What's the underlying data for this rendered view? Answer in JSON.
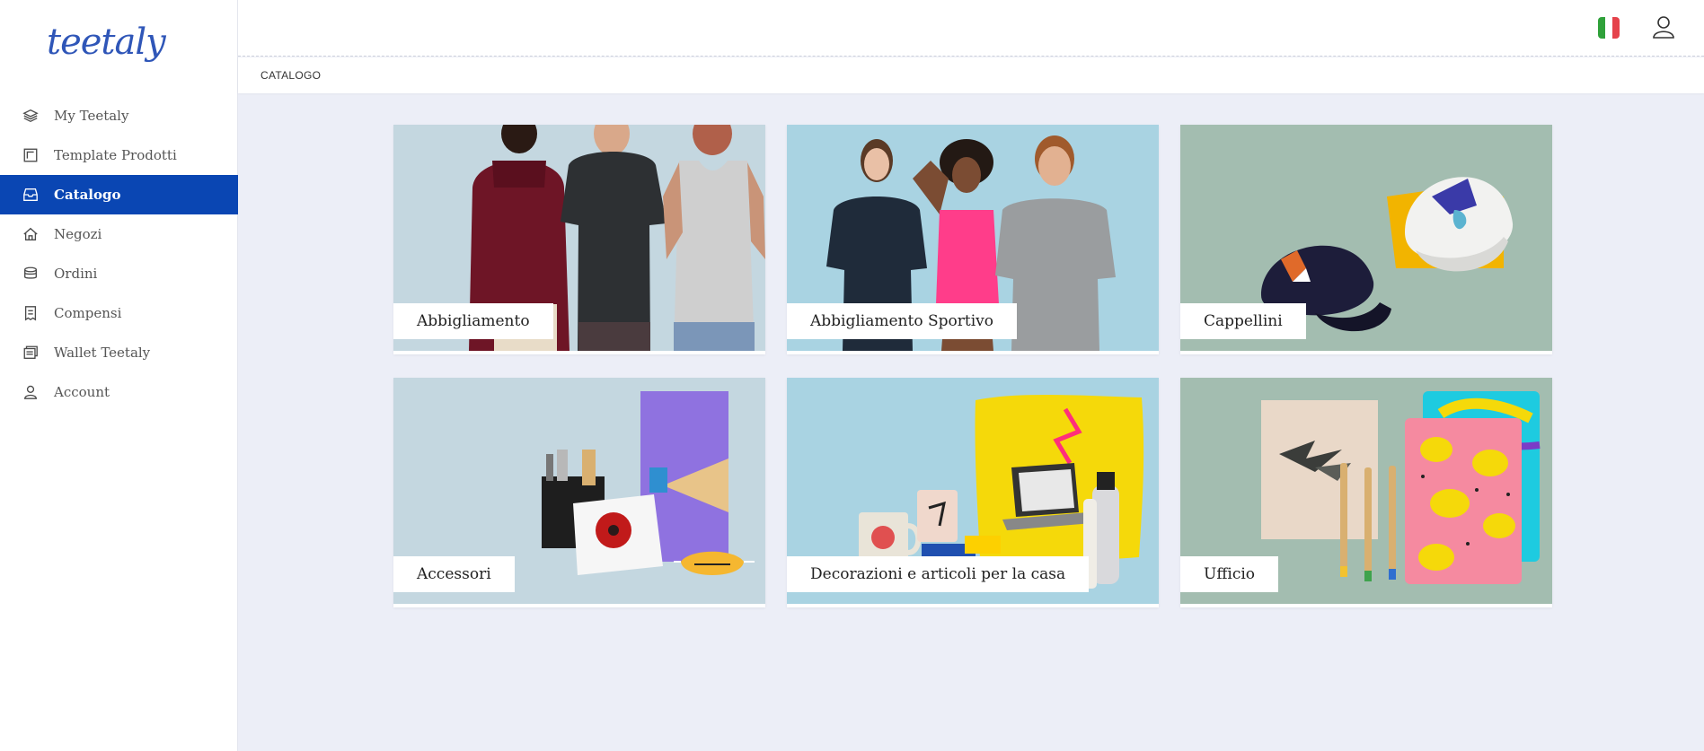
{
  "brand": {
    "logo_text": "teetaly",
    "accent": "#0a46b3"
  },
  "sidebar": {
    "items": [
      {
        "label": "My Teetaly",
        "icon": "layers-icon",
        "active": false
      },
      {
        "label": "Template Prodotti",
        "icon": "template-icon",
        "active": false
      },
      {
        "label": "Catalogo",
        "icon": "inbox-icon",
        "active": true
      },
      {
        "label": "Negozi",
        "icon": "home-icon",
        "active": false
      },
      {
        "label": "Ordini",
        "icon": "stack-icon",
        "active": false
      },
      {
        "label": "Compensi",
        "icon": "receipt-icon",
        "active": false
      },
      {
        "label": "Wallet Teetaly",
        "icon": "wallet-icon",
        "active": false
      },
      {
        "label": "Account",
        "icon": "user-icon",
        "active": false
      }
    ]
  },
  "header": {
    "language_flag": "italy-flag-icon",
    "user_icon": "user-icon"
  },
  "breadcrumb": {
    "current": "CATALOGO"
  },
  "catalog": {
    "categories": [
      {
        "label": "Abbigliamento",
        "bg": "#c4d7e0"
      },
      {
        "label": "Abbigliamento Sportivo",
        "bg": "#a9d3e2"
      },
      {
        "label": "Cappellini",
        "bg": "#a3bdb0"
      },
      {
        "label": "Accessori",
        "bg": "#c4d7e0"
      },
      {
        "label": "Decorazioni e articoli per la casa",
        "bg": "#a9d3e2"
      },
      {
        "label": "Ufficio",
        "bg": "#a3bdb0"
      }
    ]
  }
}
